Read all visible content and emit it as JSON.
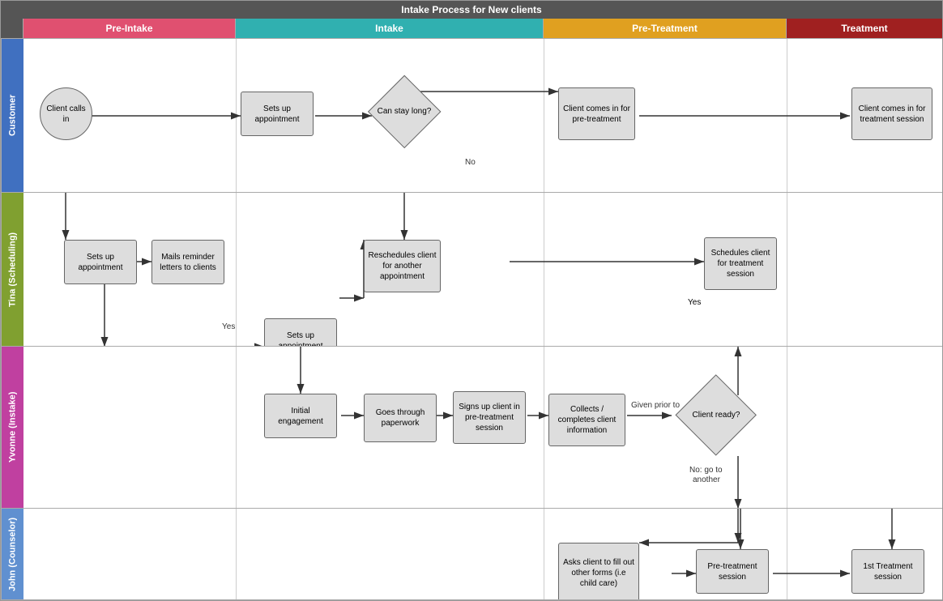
{
  "title": "Intake Process for New clients",
  "phases": [
    {
      "id": "preintake",
      "label": "Pre-Intake",
      "cssClass": "phase-preintake"
    },
    {
      "id": "intake",
      "label": "Intake",
      "cssClass": "phase-intake"
    },
    {
      "id": "pretreatment",
      "label": "Pre-Treatment",
      "cssClass": "phase-pretreatment"
    },
    {
      "id": "treatment",
      "label": "Treatment",
      "cssClass": "phase-treatment"
    }
  ],
  "lanes": [
    {
      "id": "customer",
      "label": "Customer",
      "cssClass": "lane-customer"
    },
    {
      "id": "tina",
      "label": "Tina (Scheduling)",
      "cssClass": "lane-tina"
    },
    {
      "id": "yvonne",
      "label": "Yvonne (Instake)",
      "cssClass": "lane-yvonne"
    },
    {
      "id": "john",
      "label": "John (Counselor)",
      "cssClass": "lane-john"
    }
  ],
  "nodes": {
    "client_calls_in": "Client calls in",
    "sets_up_appt_customer": "Sets up appointment",
    "can_stay_long": "Can stay long?",
    "client_comes_pretreatment": "Client comes in for pre-treatment",
    "client_comes_treatment": "Client comes in for treatment session",
    "sets_up_appt_tina1": "Sets up appointment",
    "mails_reminder": "Mails reminder letters to clients",
    "sets_up_appt_tina2": "Sets up appointment",
    "reschedules_client": "Reschedules client for another appointment",
    "schedules_client_treatment": "Schedules client for treatment session",
    "initial_engagement": "Initial engagement",
    "goes_through_paperwork": "Goes through paperwork",
    "signs_up_client": "Signs up client in pre-treatment session",
    "collects_info": "Collects / completes client information",
    "client_ready": "Client ready?",
    "asks_client": "Asks client to fill out other forms (i.e child care)",
    "pre_treatment_session": "Pre-treatment session",
    "first_treatment_session": "1st Treatment session"
  },
  "arrow_labels": {
    "no": "No",
    "yes": "Yes",
    "given_prior_to": "Given prior to",
    "no_go_another": "No: go to another"
  }
}
